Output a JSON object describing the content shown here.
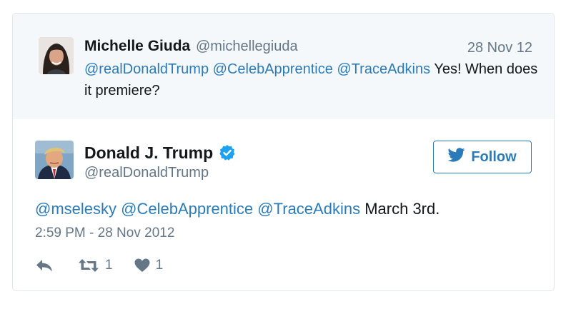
{
  "quoted_tweet": {
    "author_name": "Michelle Giuda",
    "author_handle": "@michellegiuda",
    "date": "28 Nov 12",
    "mentions": [
      "@realDonaldTrump",
      "@CelebApprentice",
      "@TraceAdkins"
    ],
    "text": "Yes! When does it premiere?"
  },
  "main_tweet": {
    "author_name": "Donald J. Trump",
    "author_handle": "@realDonaldTrump",
    "verified": true,
    "follow_label": "Follow",
    "mentions": [
      "@mselesky",
      "@CelebApprentice",
      "@TraceAdkins"
    ],
    "text": "March 3rd.",
    "timestamp": "2:59 PM - 28 Nov 2012",
    "retweet_count": "1",
    "like_count": "1"
  },
  "colors": {
    "link": "#2b7bb9",
    "muted": "#657786",
    "verified": "#1da1f2",
    "quoted_bg": "#f5f8fa"
  },
  "icons": [
    "reply-icon",
    "retweet-icon",
    "heart-icon",
    "twitter-bird-icon",
    "verified-badge-icon"
  ]
}
